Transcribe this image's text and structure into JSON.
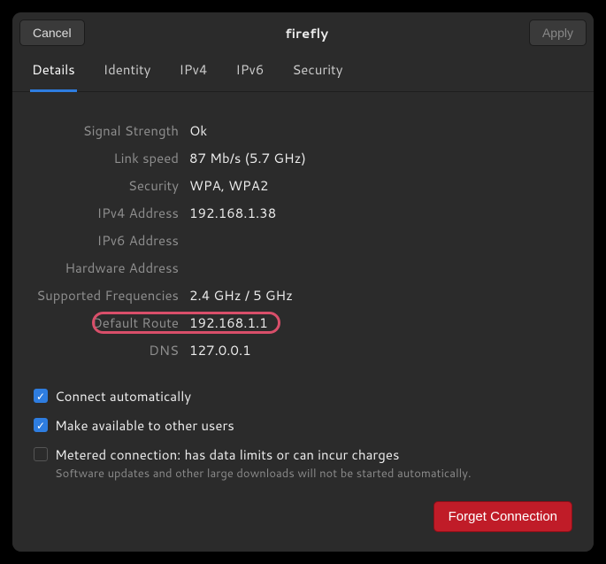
{
  "titlebar": {
    "cancel": "Cancel",
    "title": "firefly",
    "apply": "Apply"
  },
  "tabs": [
    {
      "label": "Details",
      "active": true
    },
    {
      "label": "Identity",
      "active": false
    },
    {
      "label": "IPv4",
      "active": false
    },
    {
      "label": "IPv6",
      "active": false
    },
    {
      "label": "Security",
      "active": false
    }
  ],
  "details": {
    "signal_strength": {
      "label": "Signal Strength",
      "value": "Ok"
    },
    "link_speed": {
      "label": "Link speed",
      "value": "87 Mb/s (5.7 GHz)"
    },
    "security": {
      "label": "Security",
      "value": "WPA, WPA2"
    },
    "ipv4_address": {
      "label": "IPv4 Address",
      "value": "192.168.1.38"
    },
    "ipv6_address": {
      "label": "IPv6 Address",
      "value": ""
    },
    "hardware_address": {
      "label": "Hardware Address",
      "value": ""
    },
    "supported_freq": {
      "label": "Supported Frequencies",
      "value": "2.4 GHz / 5 GHz"
    },
    "default_route": {
      "label": "Default Route",
      "value": "192.168.1.1"
    },
    "dns": {
      "label": "DNS",
      "value": "127.0.0.1"
    }
  },
  "options": {
    "connect_auto": {
      "label": "Connect automatically",
      "checked": true
    },
    "share_users": {
      "label": "Make available to other users",
      "checked": true
    },
    "metered": {
      "label": "Metered connection: has data limits or can incur charges",
      "sub": "Software updates and other large downloads will not be started automatically.",
      "checked": false
    }
  },
  "footer": {
    "forget": "Forget Connection"
  }
}
